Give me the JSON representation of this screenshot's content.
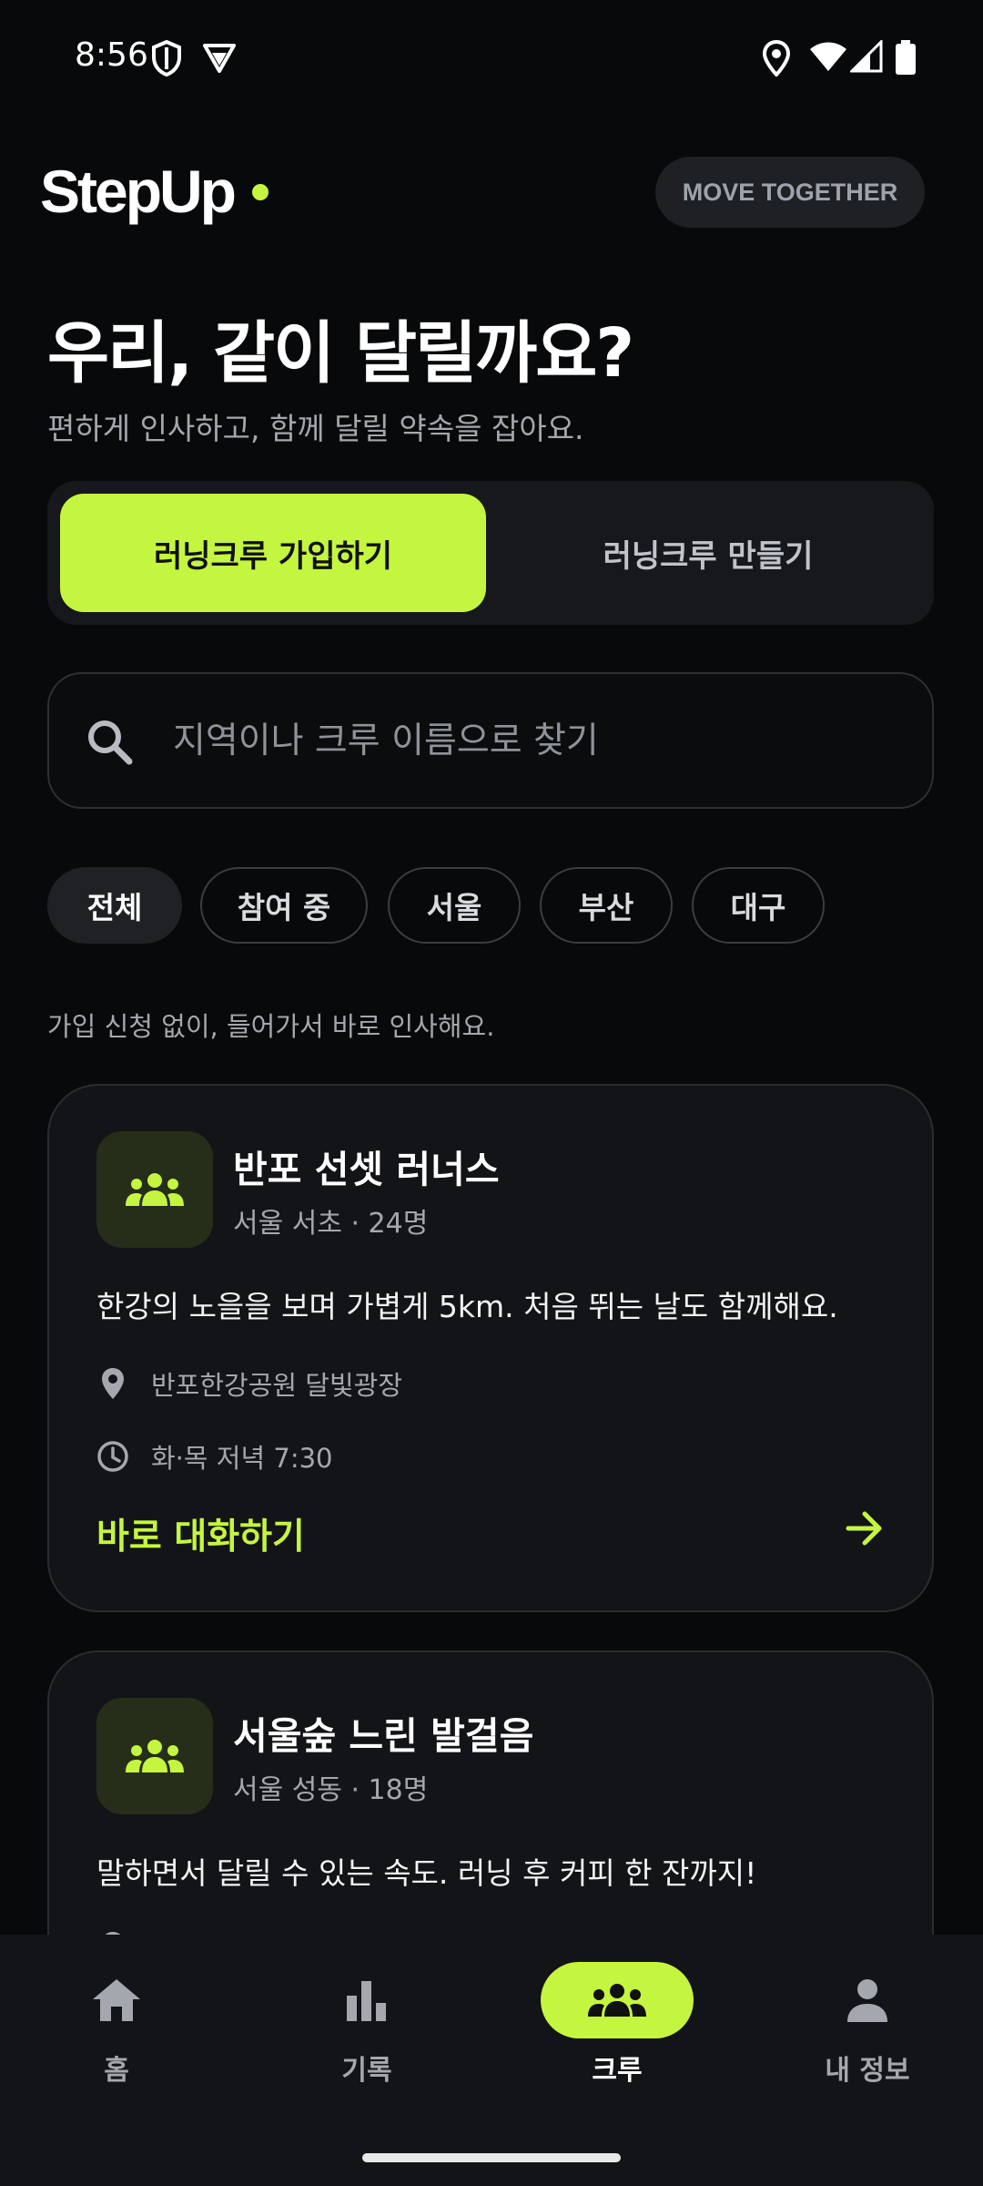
{
  "status_bar": {
    "time": "8:56"
  },
  "header": {
    "logo": "StepUp",
    "badge": "MOVE TOGETHER"
  },
  "hero": {
    "title": "우리, 같이 달릴까요?",
    "subtitle": "편하게 인사하고, 함께 달릴 약속을 잡아요."
  },
  "segment": {
    "join": "러닝크루 가입하기",
    "create": "러닝크루 만들기"
  },
  "search": {
    "placeholder": "지역이나 크루 이름으로 찾기"
  },
  "filters": [
    "전체",
    "참여 중",
    "서울",
    "부산",
    "대구"
  ],
  "info": "가입 신청 없이, 들어가서 바로 인사해요.",
  "crews": [
    {
      "name": "반포 선셋 러너스",
      "meta": "서울 서초 · 24명",
      "description": "한강의 노을을 보며 가볍게 5km. 처음 뛰는 날도 함께해요.",
      "location": "반포한강공원 달빛광장",
      "schedule": "화·목 저녁 7:30",
      "cta": "바로 대화하기"
    },
    {
      "name": "서울숲 느린 발걸음",
      "meta": "서울 성동 · 18명",
      "description": "말하면서 달릴 수 있는 속도. 러닝 후 커피 한 잔까지!"
    }
  ],
  "nav": {
    "home": "홈",
    "records": "기록",
    "crew": "크루",
    "profile": "내 정보"
  },
  "colors": {
    "accent": "#c5f63f",
    "background": "#08090a",
    "card": "#131417"
  }
}
